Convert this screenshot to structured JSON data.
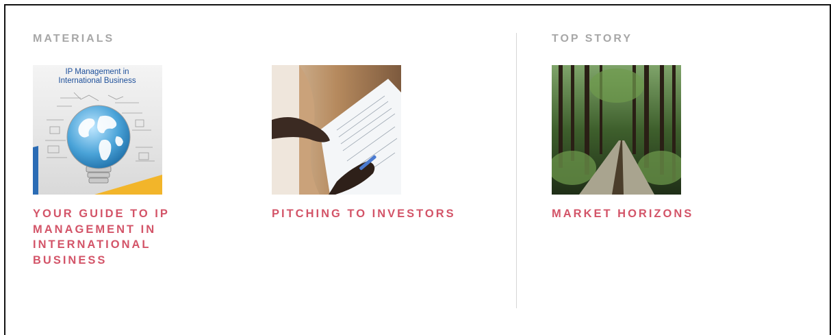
{
  "materials": {
    "section_title": "MATERIALS",
    "items": [
      {
        "title": "YOUR GUIDE TO IP MANAGEMENT IN INTERNATIONAL BUSINESS",
        "cover_title_line1": "IP Management in",
        "cover_title_line2": "International Business",
        "icon": "book-cover-globe-lightbulb"
      },
      {
        "title": "PITCHING TO INVESTORS",
        "icon": "photo-hands-document"
      }
    ]
  },
  "top_story": {
    "section_title": "TOP STORY",
    "items": [
      {
        "title": "MARKET HORIZONS",
        "icon": "photo-forest-boardwalk"
      }
    ]
  },
  "colors": {
    "section_title": "#a7a7a7",
    "link_title": "#d35468",
    "divider": "#d6d6d6"
  }
}
